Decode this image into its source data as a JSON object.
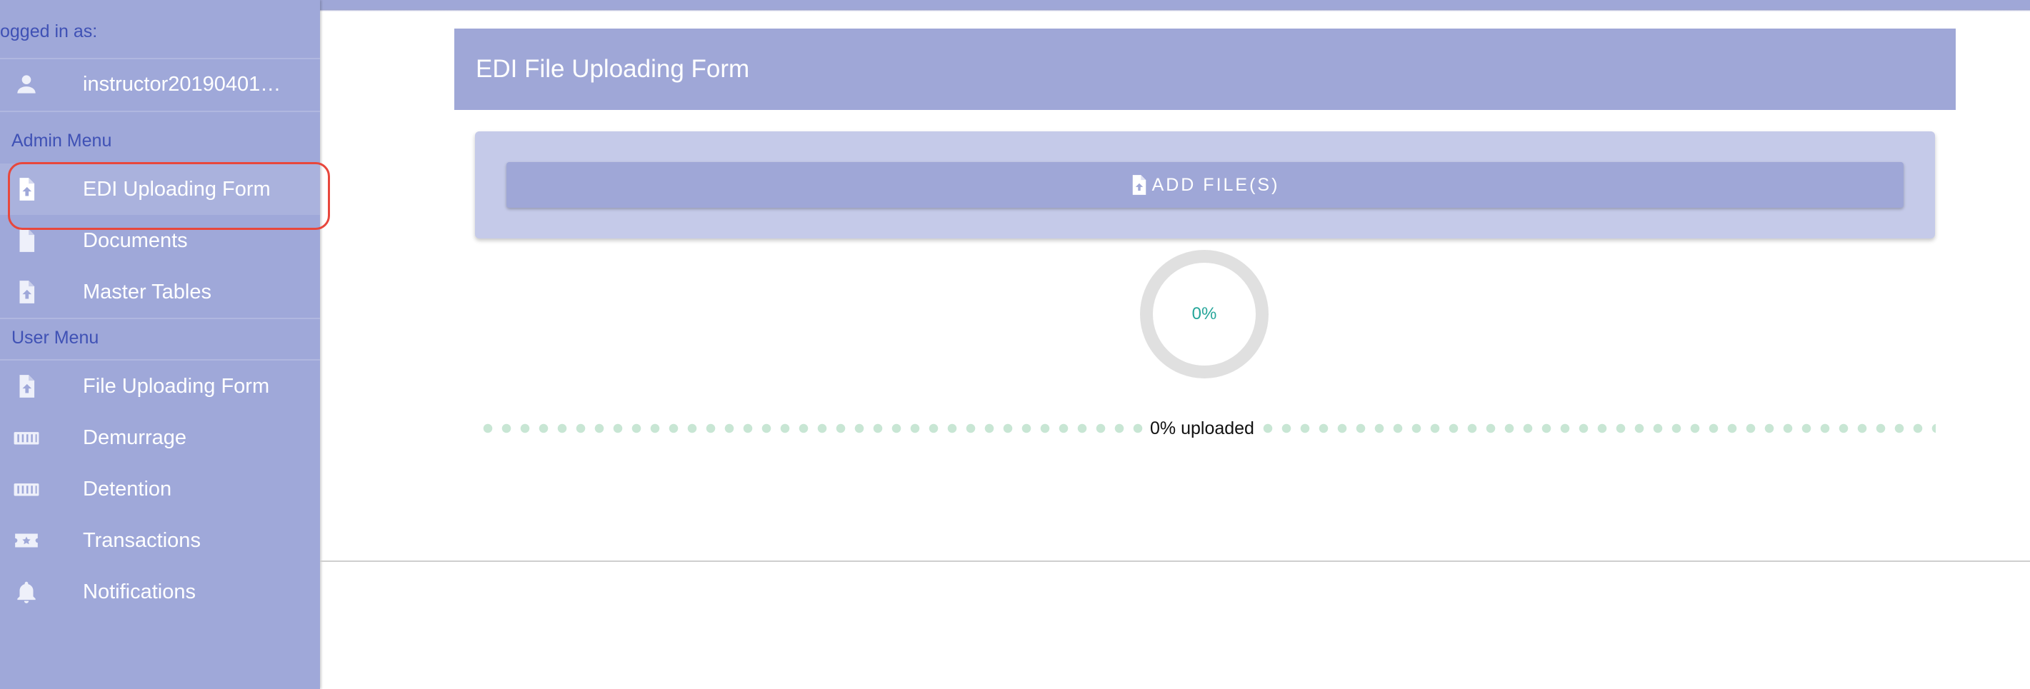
{
  "sidebar": {
    "logged_in_label": "ogged in as:",
    "username": "instructor20190401…",
    "admin_menu_title": "Admin Menu",
    "admin_items": [
      {
        "label": "EDI Uploading Form",
        "icon": "file-upload-icon",
        "active": true
      },
      {
        "label": "Documents",
        "icon": "file-icon"
      },
      {
        "label": "Master Tables",
        "icon": "file-upload-icon"
      }
    ],
    "user_menu_title": "User Menu",
    "user_items": [
      {
        "label": "File Uploading Form",
        "icon": "file-upload-icon"
      },
      {
        "label": "Demurrage",
        "icon": "container-icon"
      },
      {
        "label": "Detention",
        "icon": "container-icon"
      },
      {
        "label": "Transactions",
        "icon": "ticket-star-icon"
      },
      {
        "label": "Notifications",
        "icon": "bell-icon"
      }
    ]
  },
  "main": {
    "form_title": "EDI File Uploading Form",
    "add_files_label": "ADD FILE(S)",
    "progress_text": "0%",
    "progress_value": 0,
    "upload_status": "0% uploaded"
  },
  "colors": {
    "sidebar_bg": "#9fa8d9",
    "header_bg": "#9fa7d7",
    "card_bg": "#c5cae9",
    "accent_text": "#3f51b5",
    "progress_teal": "#26a69a",
    "highlight_red": "#e8473c"
  }
}
